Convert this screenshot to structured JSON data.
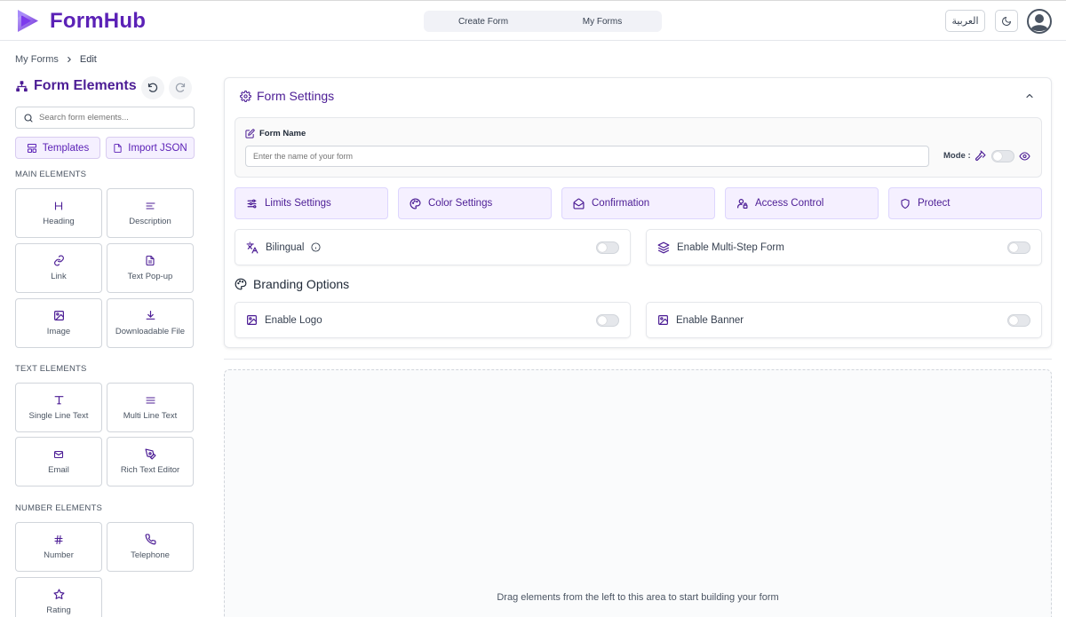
{
  "app": {
    "name": "FormHub"
  },
  "nav": {
    "create_form": "Create Form",
    "my_forms": "My Forms"
  },
  "header": {
    "language": "العربية"
  },
  "breadcrumb": {
    "root": "My Forms",
    "current": "Edit"
  },
  "sidebar": {
    "title": "Form Elements",
    "search_placeholder": "Search form elements...",
    "templates": "Templates",
    "import_json": "Import JSON",
    "sections": [
      {
        "label": "MAIN ELEMENTS",
        "items": [
          "Heading",
          "Description",
          "Link",
          "Text Pop-up",
          "Image",
          "Downloadable File"
        ]
      },
      {
        "label": "TEXT ELEMENTS",
        "items": [
          "Single Line Text",
          "Multi Line Text",
          "Email",
          "Rich Text Editor"
        ]
      },
      {
        "label": "NUMBER ELEMENTS",
        "items": [
          "Number",
          "Telephone",
          "Rating"
        ]
      }
    ]
  },
  "form_settings": {
    "title": "Form Settings",
    "form_name_label": "Form Name",
    "form_name_placeholder": "Enter the name of your form",
    "mode_label": "Mode :",
    "buttons": [
      "Limits Settings",
      "Color Settings",
      "Confirmation",
      "Access Control",
      "Protect"
    ],
    "bilingual": "Bilingual",
    "multistep": "Enable Multi-Step Form",
    "branding_title": "Branding Options",
    "enable_logo": "Enable Logo",
    "enable_banner": "Enable Banner"
  },
  "canvas": {
    "drop_hint": "Drag elements from the left to this area to start building your form"
  },
  "colors": {
    "brand": "#5b21b6",
    "accent_bg": "#f5f0ff",
    "accent_border": "#ddd6fe"
  }
}
